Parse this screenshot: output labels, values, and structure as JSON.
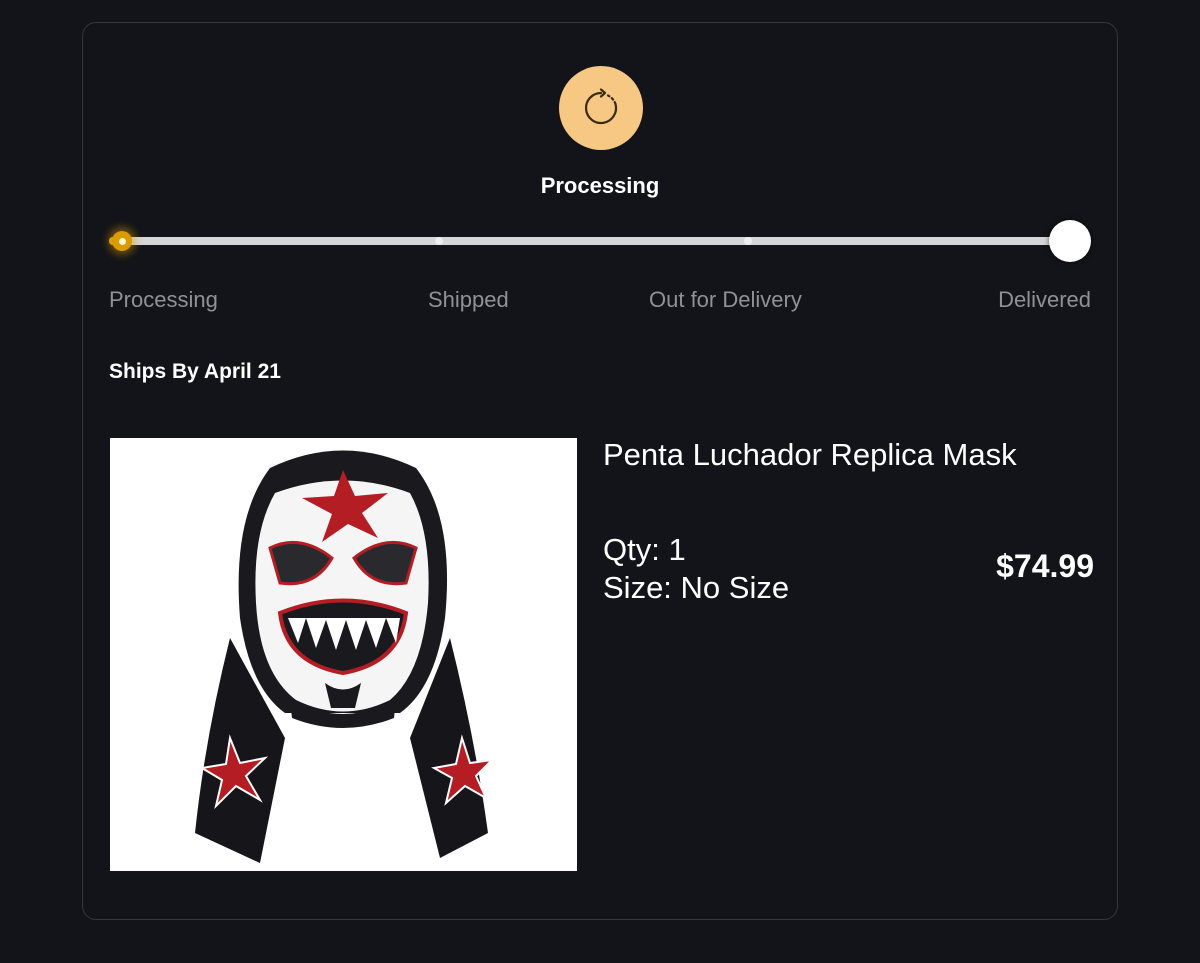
{
  "status": {
    "title": "Processing",
    "icon": "processing-spinner-icon",
    "accent_color": "#f7c784",
    "progress_fraction": 0.0
  },
  "steps": [
    "Processing",
    "Shipped",
    "Out for Delivery",
    "Delivered"
  ],
  "shipping": {
    "ships_by": "Ships By April 21"
  },
  "product": {
    "name": "Penta Luchador Replica Mask",
    "qty": "Qty: 1",
    "size": "Size: No Size",
    "price": "$74.99",
    "image": "luchador-mask-image"
  }
}
